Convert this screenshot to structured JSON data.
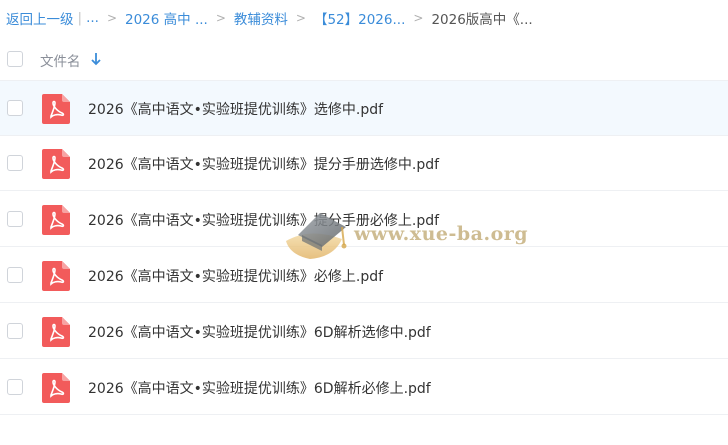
{
  "breadcrumb": {
    "back": "返回上一级",
    "ellipsis": "...",
    "items": [
      "2026 高中 ...",
      "教辅资料",
      "【52】2026...",
      "2026版高中《..."
    ],
    "separator": ">"
  },
  "header": {
    "name_label": "文件名"
  },
  "files": [
    {
      "name": "2026《高中语文•实验班提优训练》选修中.pdf",
      "icon": "pdf-icon"
    },
    {
      "name": "2026《高中语文•实验班提优训练》提分手册选修中.pdf",
      "icon": "pdf-icon"
    },
    {
      "name": "2026《高中语文•实验班提优训练》提分手册必修上.pdf",
      "icon": "pdf-icon"
    },
    {
      "name": "2026《高中语文•实验班提优训练》必修上.pdf",
      "icon": "pdf-icon"
    },
    {
      "name": "2026《高中语文•实验班提优训练》6D解析选修中.pdf",
      "icon": "pdf-icon"
    },
    {
      "name": "2026《高中语文•实验班提优训练》6D解析必修上.pdf",
      "icon": "pdf-icon"
    }
  ],
  "watermark": {
    "text": "www.xue-ba.org"
  },
  "colors": {
    "link": "#3b8cd9",
    "pdf": "#f25b5b",
    "hover_row": "#f3f9fe"
  }
}
